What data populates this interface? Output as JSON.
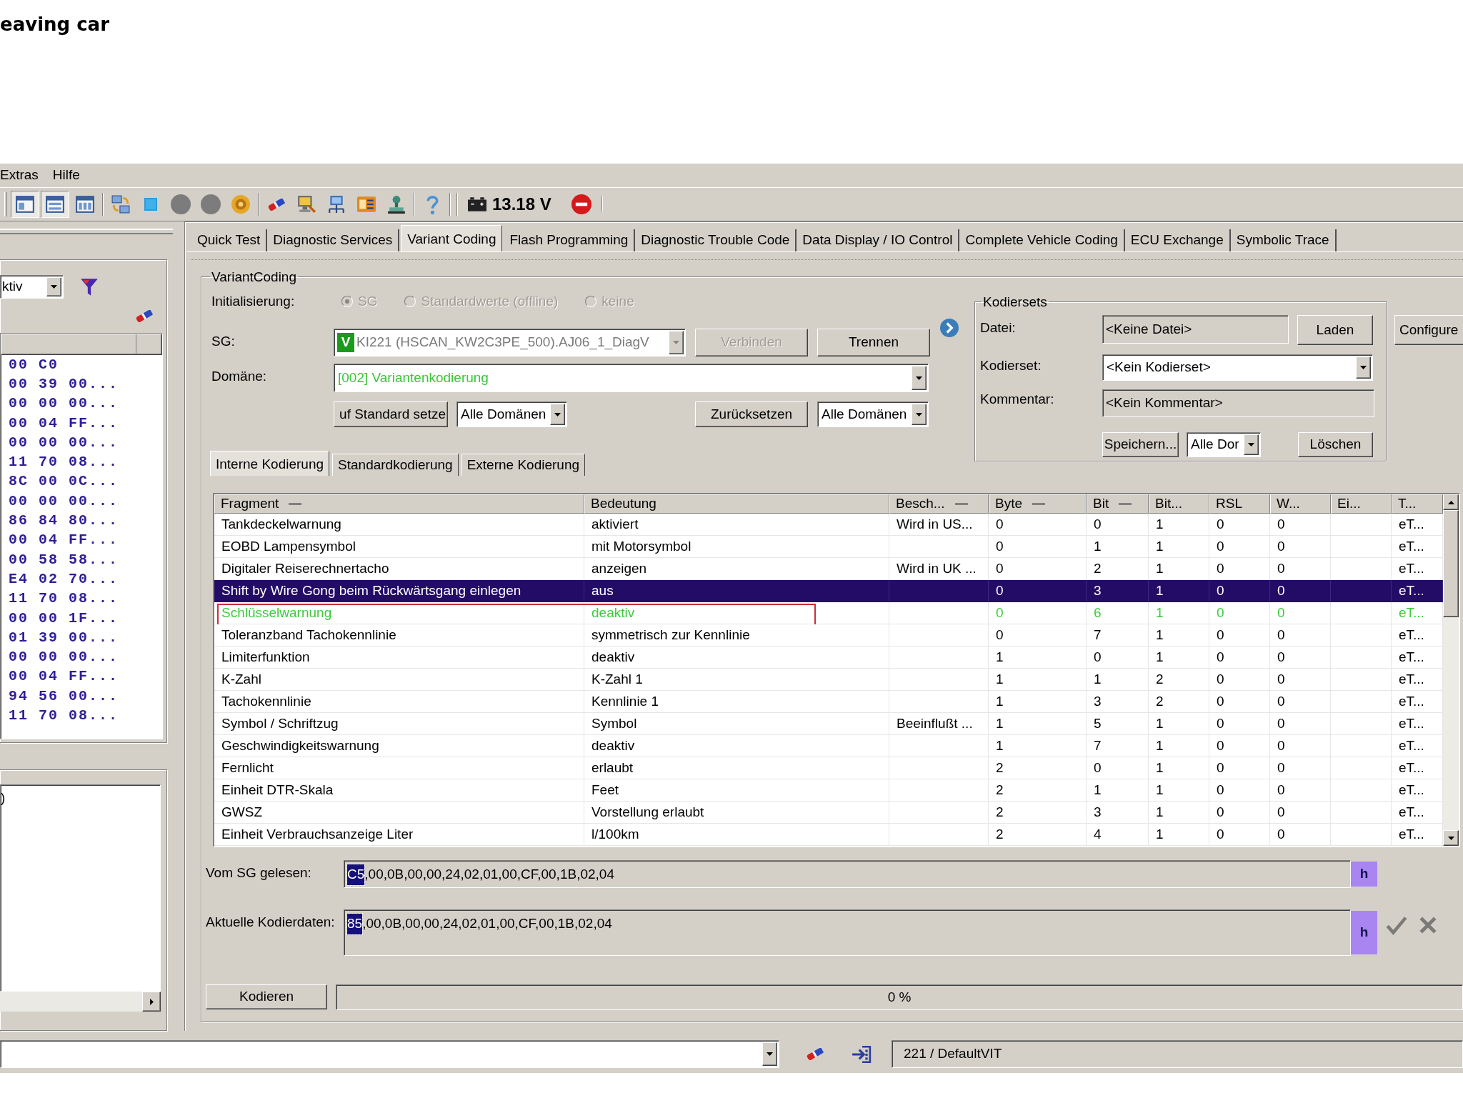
{
  "page_title": "eaving car",
  "menu": [
    {
      "label": "Extras"
    },
    {
      "label": "Hilfe"
    }
  ],
  "toolbar": {
    "layout_buttons": [
      {
        "pressed": true
      },
      {
        "pressed": true
      },
      {
        "pressed": false
      }
    ],
    "voltage": "13.18 V"
  },
  "left_panel": {
    "filter": {
      "value": "ktiv"
    },
    "hex_rows": [
      "00 C0",
      "00 39 00...",
      "00 00 00...",
      "00 04 FF...",
      "00 00 00...",
      "11 70 08...",
      "8C 00 0C...",
      "00 00 00...",
      "86 84 80...",
      "00 04 FF...",
      "00 58 58...",
      "E4 02 70...",
      "11 70 08...",
      "00 00 1F...",
      "01 39 00...",
      "00 00 00...",
      "00 04 FF...",
      "94 56 00...",
      "11 70 08..."
    ],
    "log_text": ")"
  },
  "tabs": [
    {
      "label": "Quick Test",
      "selected": false
    },
    {
      "label": "Diagnostic Services",
      "selected": false
    },
    {
      "label": "Variant Coding",
      "selected": true
    },
    {
      "label": "Flash Programming",
      "selected": false
    },
    {
      "label": "Diagnostic Trouble Code",
      "selected": false
    },
    {
      "label": "Data Display / IO Control",
      "selected": false
    },
    {
      "label": "Complete Vehicle Coding",
      "selected": false
    },
    {
      "label": "ECU Exchange",
      "selected": false
    },
    {
      "label": "Symbolic Trace",
      "selected": false
    }
  ],
  "variant_coding": {
    "title": "VariantCoding",
    "init": {
      "label": "Initialisierung:",
      "disabled": true,
      "options": [
        {
          "label": "SG",
          "selected": true
        },
        {
          "label": "Standardwerte (offline)",
          "selected": false
        },
        {
          "label": "keine",
          "selected": false
        }
      ]
    },
    "sg": {
      "label": "SG:",
      "badge": "V",
      "value": "KI221 (HSCAN_KW2C3PE_500).AJ06_1_DiagV",
      "disabled": true
    },
    "connect_buttons": [
      {
        "label": "Verbinden",
        "disabled": true
      },
      {
        "label": "Trennen",
        "disabled": false
      }
    ],
    "domain": {
      "label": "Domäne:",
      "value": "[002] Variantenkodierung"
    },
    "default_button": "uf Standard setze",
    "default_scope": "Alle Domänen",
    "reset_button": "Zurücksetzen",
    "reset_scope": "Alle Domänen"
  },
  "kodiersets": {
    "title": "Kodiersets",
    "file_label": "Datei:",
    "file_value": "<Keine Datei>",
    "load_button": "Laden",
    "set_label": "Kodierset:",
    "set_value": "<Kein Kodierset>",
    "comment_label": "Kommentar:",
    "comment_value": "<Kein Kommentar>",
    "save_button": "Speichern...",
    "save_scope": "Alle Dor",
    "delete_button": "Löschen"
  },
  "configure_button": "Configure",
  "coding_tabs": [
    {
      "label": "Interne Kodierung",
      "selected": true
    },
    {
      "label": "Standardkodierung",
      "selected": false
    },
    {
      "label": "Externe Kodierung",
      "selected": false
    }
  ],
  "table": {
    "columns": [
      {
        "label": "Fragment",
        "dash": true
      },
      {
        "label": "Bedeutung",
        "dash": false
      },
      {
        "label": "Besch...",
        "dash": true
      },
      {
        "label": "Byte",
        "dash": true
      },
      {
        "label": "Bit",
        "dash": true
      },
      {
        "label": "Bit...",
        "dash": false
      },
      {
        "label": "RSL",
        "dash": false
      },
      {
        "label": "W...",
        "dash": false
      },
      {
        "label": "Ei...",
        "dash": false
      },
      {
        "label": "T...",
        "dash": false
      }
    ],
    "rows": [
      {
        "cells": [
          "Tankdeckelwarnung",
          "aktiviert",
          "Wird in US...",
          "0",
          "0",
          "1",
          "0",
          "0",
          null,
          "eT..."
        ],
        "selected": false,
        "modified": false,
        "outlined": false
      },
      {
        "cells": [
          "EOBD Lampensymbol",
          "mit Motorsymbol",
          null,
          "0",
          "1",
          "1",
          "0",
          "0",
          null,
          "eT..."
        ],
        "selected": false,
        "modified": false,
        "outlined": false
      },
      {
        "cells": [
          "Digitaler Reiserechnertacho",
          "anzeigen",
          "Wird in UK ...",
          "0",
          "2",
          "1",
          "0",
          "0",
          null,
          "eT..."
        ],
        "selected": false,
        "modified": false,
        "outlined": false
      },
      {
        "cells": [
          "Shift by Wire Gong beim Rückwärtsgang einlegen",
          "aus",
          null,
          "0",
          "3",
          "1",
          "0",
          "0",
          null,
          "eT..."
        ],
        "selected": true,
        "modified": false,
        "outlined": false
      },
      {
        "cells": [
          "Schlüsselwarnung",
          "deaktiv",
          null,
          "0",
          "6",
          "1",
          "0",
          "0",
          null,
          "eT..."
        ],
        "selected": false,
        "modified": true,
        "outlined": true
      },
      {
        "cells": [
          "Toleranzband Tachokennlinie",
          "symmetrisch zur Kennlinie",
          null,
          "0",
          "7",
          "1",
          "0",
          "0",
          null,
          "eT..."
        ],
        "selected": false,
        "modified": false,
        "outlined": false
      },
      {
        "cells": [
          "Limiterfunktion",
          "deaktiv",
          null,
          "1",
          "0",
          "1",
          "0",
          "0",
          null,
          "eT..."
        ],
        "selected": false,
        "modified": false,
        "outlined": false
      },
      {
        "cells": [
          "K-Zahl",
          "K-Zahl 1",
          null,
          "1",
          "1",
          "2",
          "0",
          "0",
          null,
          "eT..."
        ],
        "selected": false,
        "modified": false,
        "outlined": false
      },
      {
        "cells": [
          "Tachokennlinie",
          "Kennlinie 1",
          null,
          "1",
          "3",
          "2",
          "0",
          "0",
          null,
          "eT..."
        ],
        "selected": false,
        "modified": false,
        "outlined": false
      },
      {
        "cells": [
          "Symbol / Schriftzug",
          "Symbol",
          "Beeinflußt ...",
          "1",
          "5",
          "1",
          "0",
          "0",
          null,
          "eT..."
        ],
        "selected": false,
        "modified": false,
        "outlined": false
      },
      {
        "cells": [
          "Geschwindigkeitswarnung",
          "deaktiv",
          null,
          "1",
          "7",
          "1",
          "0",
          "0",
          null,
          "eT..."
        ],
        "selected": false,
        "modified": false,
        "outlined": false
      },
      {
        "cells": [
          "Fernlicht",
          "erlaubt",
          null,
          "2",
          "0",
          "1",
          "0",
          "0",
          null,
          "eT..."
        ],
        "selected": false,
        "modified": false,
        "outlined": false
      },
      {
        "cells": [
          "Einheit DTR-Skala",
          "Feet",
          null,
          "2",
          "1",
          "1",
          "0",
          "0",
          null,
          "eT..."
        ],
        "selected": false,
        "modified": false,
        "outlined": false
      },
      {
        "cells": [
          "GWSZ",
          "Vorstellung erlaubt",
          null,
          "2",
          "3",
          "1",
          "0",
          "0",
          null,
          "eT..."
        ],
        "selected": false,
        "modified": false,
        "outlined": false
      },
      {
        "cells": [
          "Einheit Verbrauchsanzeige Liter",
          "l/100km",
          null,
          "2",
          "4",
          "1",
          "0",
          "0",
          null,
          "eT..."
        ],
        "selected": false,
        "modified": false,
        "outlined": false
      }
    ]
  },
  "read_data": {
    "label": "Vom SG gelesen:",
    "selected_text": "C5",
    "text": ",00,0B,00,00,24,02,01,00,CF,00,1B,02,04",
    "hex_button": "h"
  },
  "current_data": {
    "label": "Aktuelle Kodierdaten:",
    "selected_text": "85",
    "text": ",00,0B,00,00,24,02,01,00,CF,00,1B,02,04",
    "hex_button": "h"
  },
  "code_button": "Kodieren",
  "progress": {
    "level": 0,
    "reading": "0 %"
  },
  "status_bar": {
    "text": "221 / DefaultVIT"
  }
}
